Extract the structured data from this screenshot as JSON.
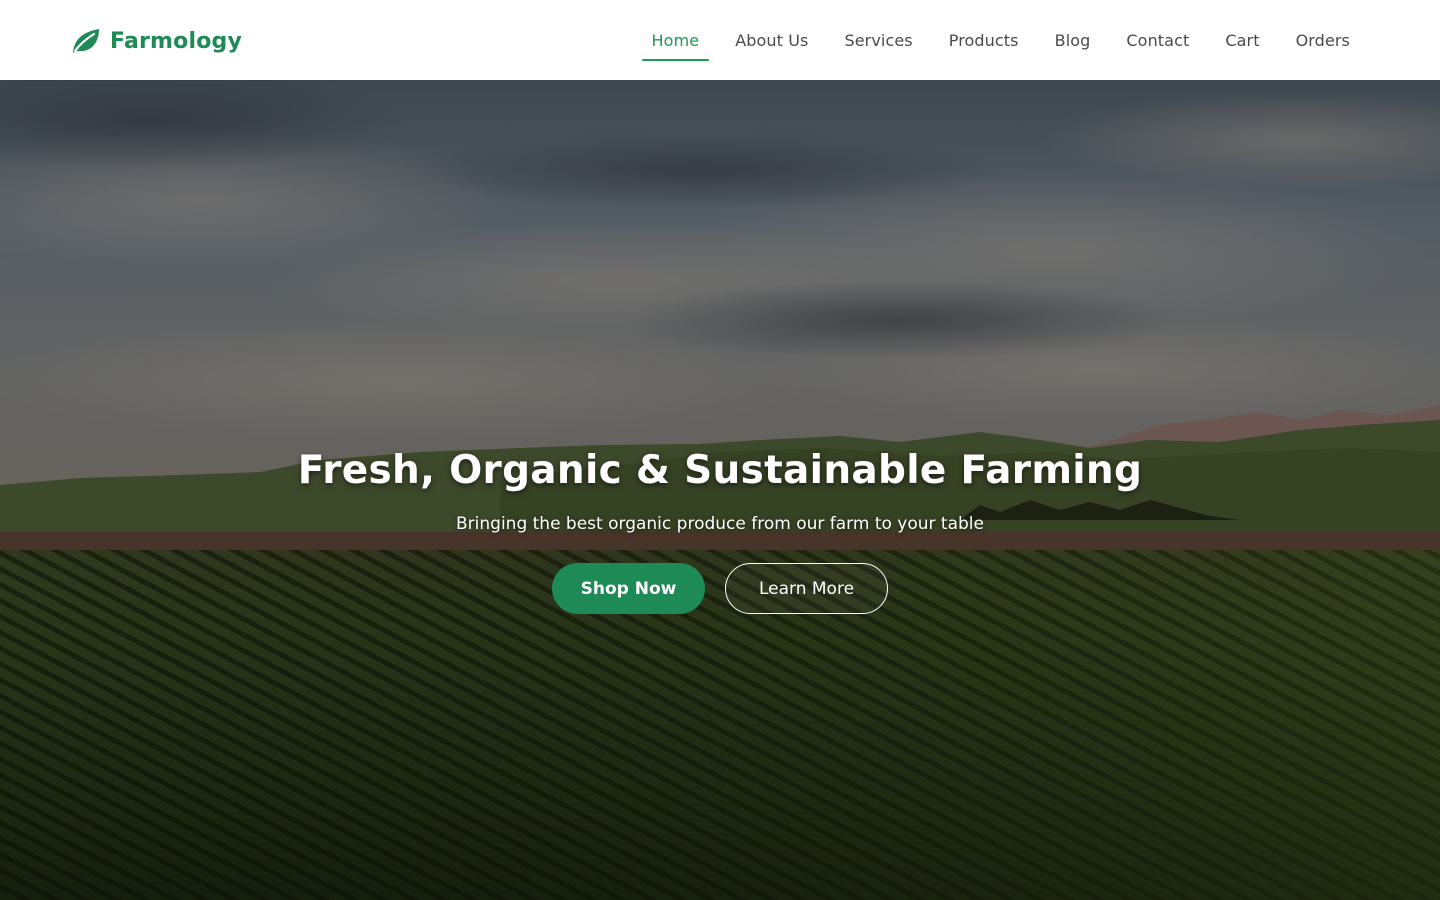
{
  "brand": {
    "name": "Farmology",
    "icon": "leaf-icon",
    "color": "#1e8a55"
  },
  "nav": {
    "items": [
      {
        "label": "Home",
        "active": true
      },
      {
        "label": "About Us"
      },
      {
        "label": "Services"
      },
      {
        "label": "Products"
      },
      {
        "label": "Blog"
      },
      {
        "label": "Contact"
      },
      {
        "label": "Cart"
      },
      {
        "label": "Orders"
      }
    ],
    "active_color": "#1e9a55"
  },
  "hero": {
    "title": "Fresh, Organic & Sustainable Farming",
    "subtitle": "Bringing the best organic produce from our farm to your table",
    "primary_button": "Shop Now",
    "secondary_button": "Learn More",
    "background": "farm-field-landscape"
  }
}
